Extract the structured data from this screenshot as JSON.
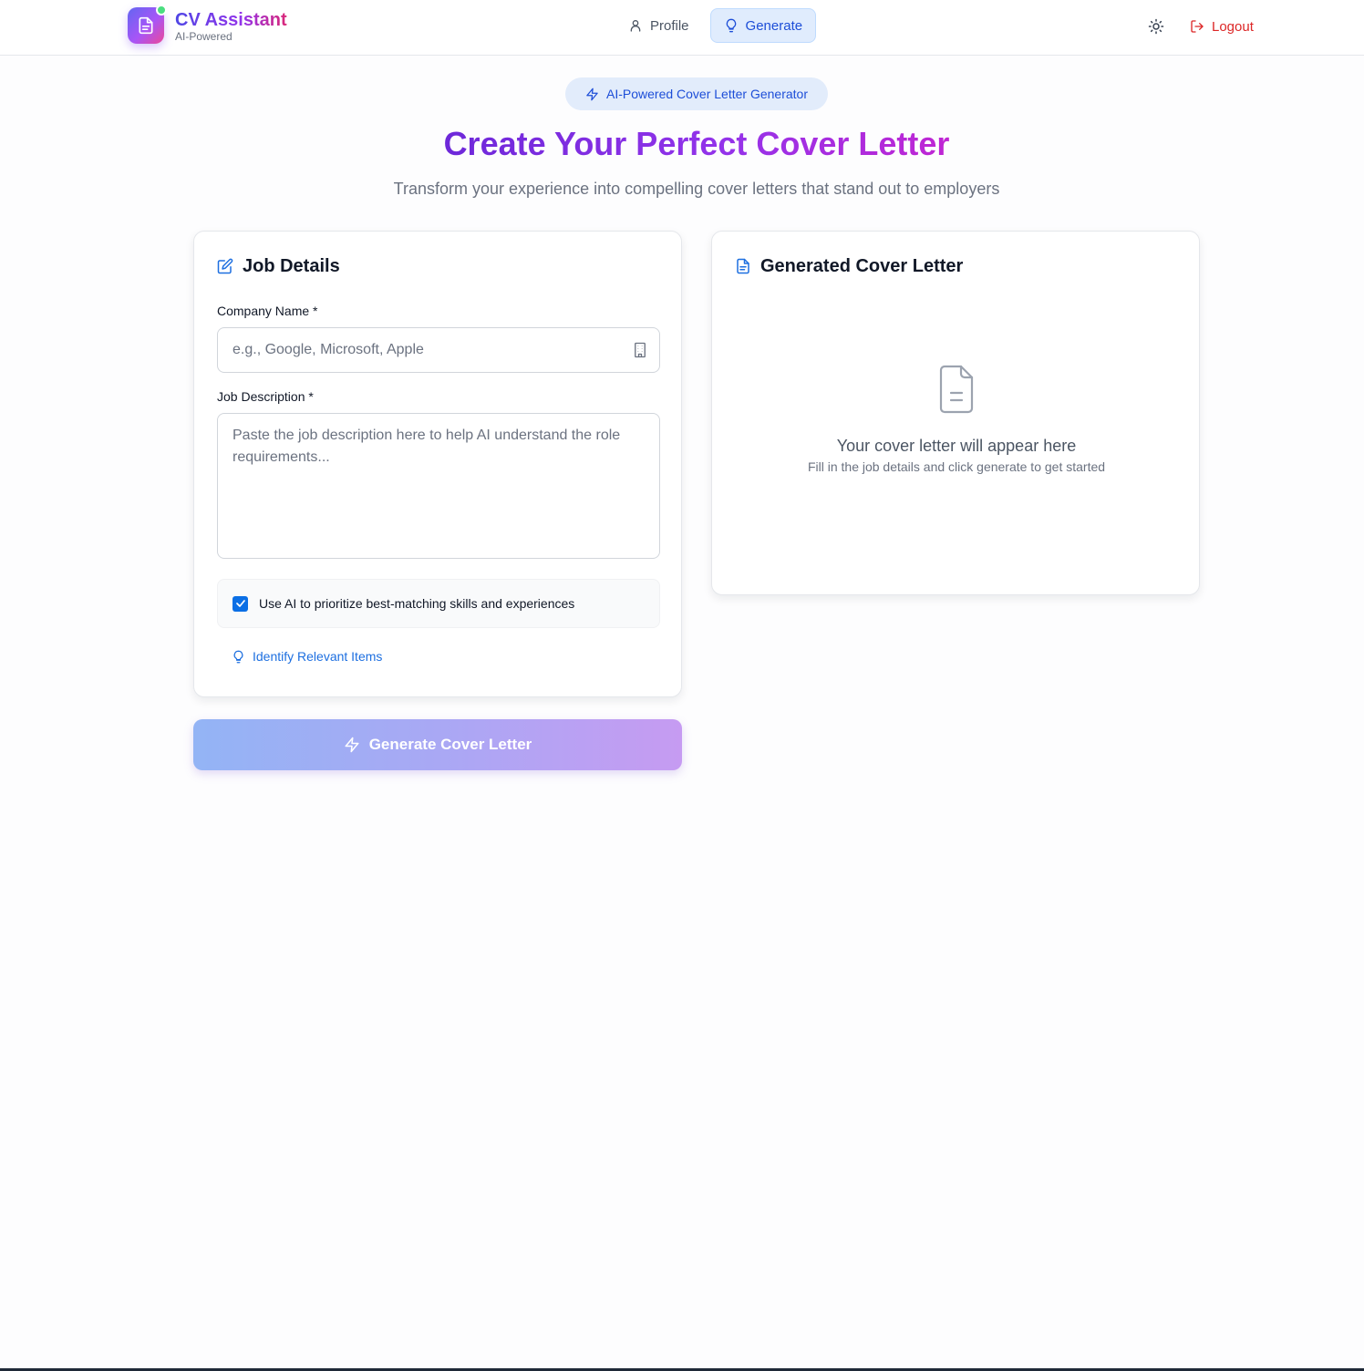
{
  "header": {
    "brand_title": "CV Assistant",
    "brand_subtitle": "AI-Powered",
    "nav": [
      {
        "label": "Profile",
        "icon": "user-icon",
        "active": false
      },
      {
        "label": "Generate",
        "icon": "lightbulb-icon",
        "active": true
      }
    ],
    "theme_icon": "sun-icon",
    "logout_label": "Logout"
  },
  "hero": {
    "badge": "AI-Powered Cover Letter Generator",
    "title": "Create Your Perfect Cover Letter",
    "subtitle": "Transform your experience into compelling cover letters that stand out to employers"
  },
  "job_details": {
    "title": "Job Details",
    "company_label": "Company Name *",
    "company_placeholder": "e.g., Google, Microsoft, Apple",
    "company_value": "",
    "description_label": "Job Description *",
    "description_placeholder": "Paste the job description here to help AI understand the role requirements...",
    "description_value": "",
    "ai_checkbox_label": "Use AI to prioritize best-matching skills and experiences",
    "ai_checkbox_checked": true,
    "identify_label": "Identify Relevant Items"
  },
  "generated": {
    "title": "Generated Cover Letter",
    "empty_title": "Your cover letter will appear here",
    "empty_subtitle": "Fill in the job details and click generate to get started"
  },
  "generate_button": "Generate Cover Letter",
  "colors": {
    "accent": "#1d4ed8",
    "logout": "#dc2626",
    "brand_gradient": [
      "#6366f1",
      "#a855f7",
      "#ec4899"
    ]
  }
}
